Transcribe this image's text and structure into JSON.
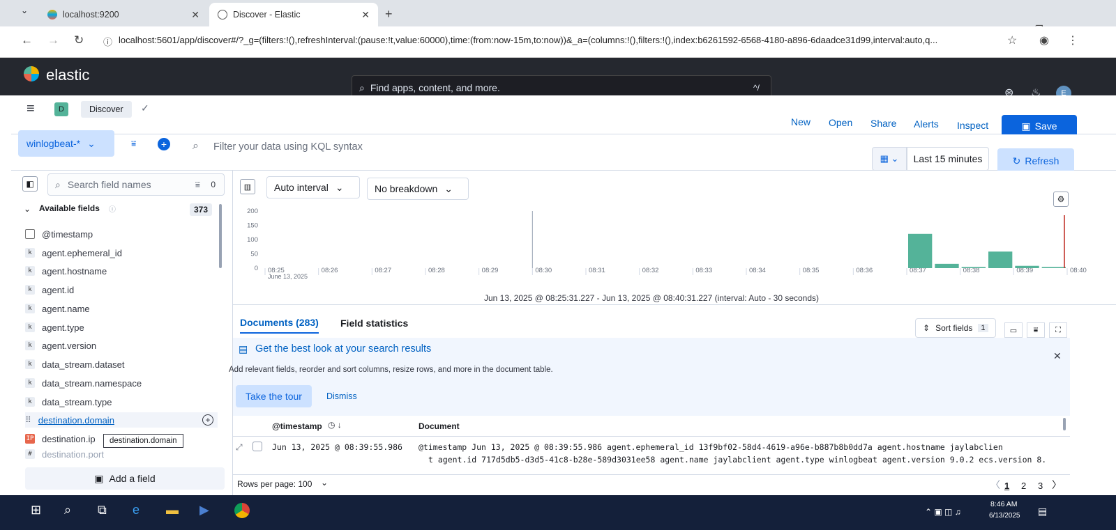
{
  "browser": {
    "tabs": [
      {
        "title": "localhost:9200"
      },
      {
        "title": "Discover - Elastic"
      }
    ],
    "new_tab": "+",
    "url": "localhost:5601/app/discover#/?_g=(filters:!(),refreshInterval:(pause:!t,value:60000),time:(from:now-15m,to:now))&_a=(columns:!(),filters:!(),index:b6261592-6568-4180-a896-6daadce31d99,interval:auto,q..."
  },
  "header": {
    "logo_text": "elastic",
    "search_placeholder": "Find apps, content, and more.",
    "search_shortcut": "^/",
    "avatar": "E"
  },
  "appbar": {
    "space_badge": "D",
    "breadcrumb": "Discover",
    "menu": [
      "New",
      "Open",
      "Share",
      "Alerts",
      "Inspect"
    ],
    "save": "Save"
  },
  "querybar": {
    "dataview": "winlogbeat-*",
    "filter_placeholder": "Filter your data using KQL syntax",
    "time_range": "Last 15 minutes",
    "refresh": "Refresh"
  },
  "sidebar": {
    "search_placeholder": "Search field names",
    "filter_count": "0",
    "available_label": "Available fields",
    "available_count": "373",
    "fields": [
      {
        "type": "date",
        "name": "@timestamp"
      },
      {
        "type": "k",
        "name": "agent.ephemeral_id"
      },
      {
        "type": "k",
        "name": "agent.hostname"
      },
      {
        "type": "k",
        "name": "agent.id"
      },
      {
        "type": "k",
        "name": "agent.name"
      },
      {
        "type": "k",
        "name": "agent.type"
      },
      {
        "type": "k",
        "name": "agent.version"
      },
      {
        "type": "k",
        "name": "data_stream.dataset"
      },
      {
        "type": "k",
        "name": "data_stream.namespace"
      },
      {
        "type": "k",
        "name": "data_stream.type"
      },
      {
        "type": "drag",
        "name": "destination.domain"
      },
      {
        "type": "ip",
        "name": "destination.ip"
      },
      {
        "type": "#",
        "name": "destination.port"
      }
    ],
    "tooltip": "destination.domain",
    "add_field": "Add a field"
  },
  "histogram": {
    "interval": "Auto interval",
    "breakdown": "No breakdown",
    "range_label": "Jun 13, 2025 @ 08:25:31.227 - Jun 13, 2025 @ 08:40:31.227 (interval: Auto - 30 seconds)"
  },
  "chart_data": {
    "type": "bar",
    "ylim": [
      0,
      200
    ],
    "y_ticks": [
      "200",
      "150",
      "100",
      "50",
      "0"
    ],
    "x_ticks": [
      "08:25",
      "08:26",
      "08:27",
      "08:28",
      "08:29",
      "08:30",
      "08:31",
      "08:32",
      "08:33",
      "08:34",
      "08:35",
      "08:36",
      "08:37",
      "08:38",
      "08:39",
      "08:40"
    ],
    "x_subtitle": "June 13, 2025",
    "categories": [
      "08:37:00",
      "08:37:30",
      "08:38:00",
      "08:38:30",
      "08:39:00",
      "08:39:30"
    ],
    "values": [
      120,
      15,
      4,
      58,
      8,
      4
    ],
    "color": "#54b399"
  },
  "documents": {
    "tab_docs": "Documents (283)",
    "tab_stats": "Field statistics",
    "sort_fields": "Sort fields",
    "sort_count": "1",
    "callout_title": "Get the best look at your search results",
    "callout_text": "Add relevant fields, reorder and sort columns, resize rows, and more in the document table.",
    "take_tour": "Take the tour",
    "dismiss": "Dismiss",
    "col_timestamp": "@timestamp",
    "col_document": "Document",
    "row_timestamp": "Jun 13, 2025 @ 08:39:55.986",
    "row_doc_line1": "@timestamp Jun 13, 2025 @ 08:39:55.986 agent.ephemeral_id 13f9bf02-58d4-4619-a96e-b887b8b0dd7a agent.hostname jaylabclien",
    "row_doc_line2": "t agent.id 717d5db5-d3d5-41c8-b28e-589d3031ee58 agent.name jaylabclient agent.type winlogbeat agent.version 9.0.2 ecs.version 8.",
    "rows_per_page": "Rows per page: 100",
    "pages": [
      "1",
      "2",
      "3"
    ]
  },
  "taskbar": {
    "time": "8:46 AM",
    "date": "6/13/2025"
  }
}
